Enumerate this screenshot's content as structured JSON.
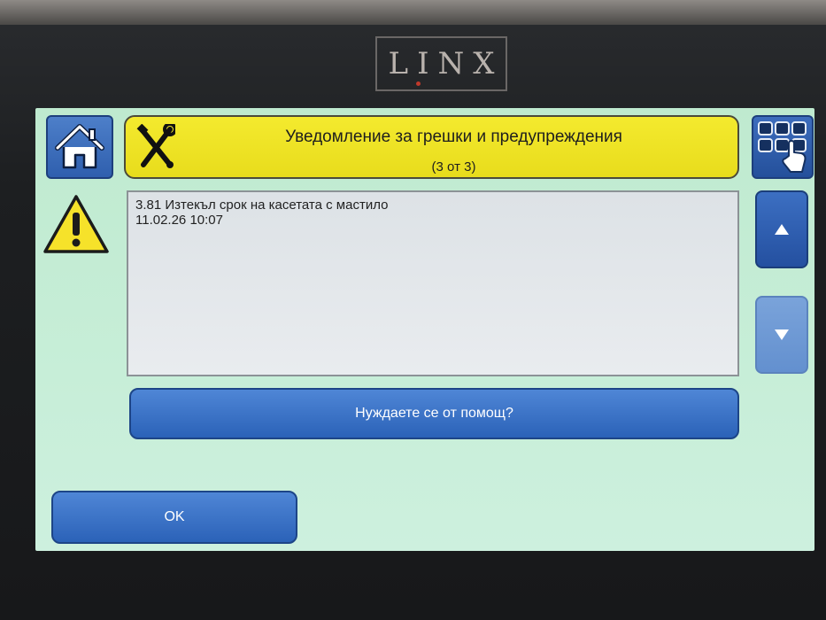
{
  "brand": {
    "name": "LINX"
  },
  "header": {
    "title": "Уведомление за грешки и предупреждения",
    "subtitle": "(3 от 3)"
  },
  "message": {
    "line1": "3.81 Изтекъл срок на касетата с мастило",
    "line2": "11.02.26 10:07"
  },
  "buttons": {
    "help_label": "Нуждаете се от помощ?",
    "ok_label": "OK"
  },
  "icons": {
    "home": "home-icon",
    "tools": "tools-icon",
    "menu": "grid-menu-icon",
    "warning": "warning-icon",
    "up": "arrow-up-icon",
    "down": "arrow-down-icon"
  },
  "colors": {
    "screen_bg": "#c7eed8",
    "header_bg": "#f0e527",
    "button_blue": "#2f5fae",
    "warning_yellow": "#f6e22a"
  }
}
